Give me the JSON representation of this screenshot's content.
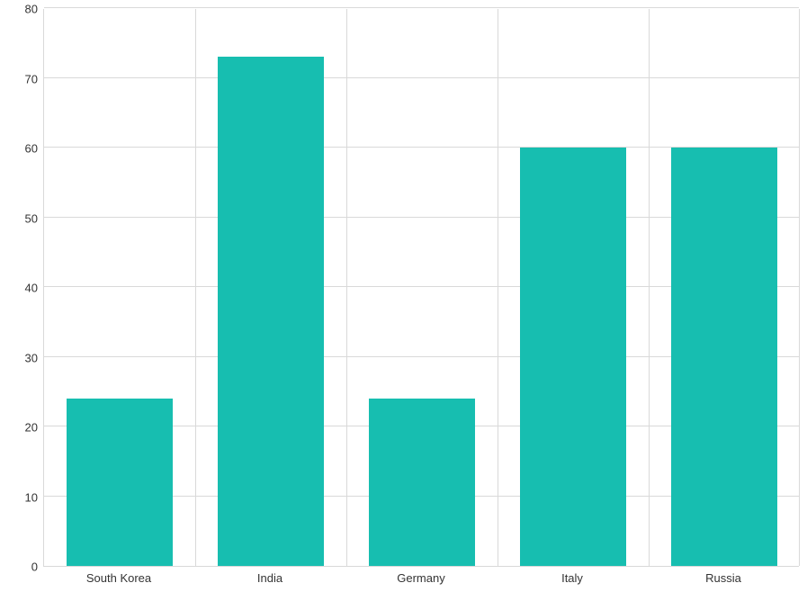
{
  "chart_data": {
    "type": "bar",
    "categories": [
      "South Korea",
      "India",
      "Germany",
      "Italy",
      "Russia"
    ],
    "values": [
      24,
      73,
      24,
      60,
      60
    ],
    "title": "",
    "xlabel": "",
    "ylabel": "",
    "ylim": [
      0,
      80
    ],
    "y_ticks": [
      0,
      10,
      20,
      30,
      40,
      50,
      60,
      70,
      80
    ],
    "bar_color": "#17beb0",
    "grid_color": "#d9d9d9"
  }
}
